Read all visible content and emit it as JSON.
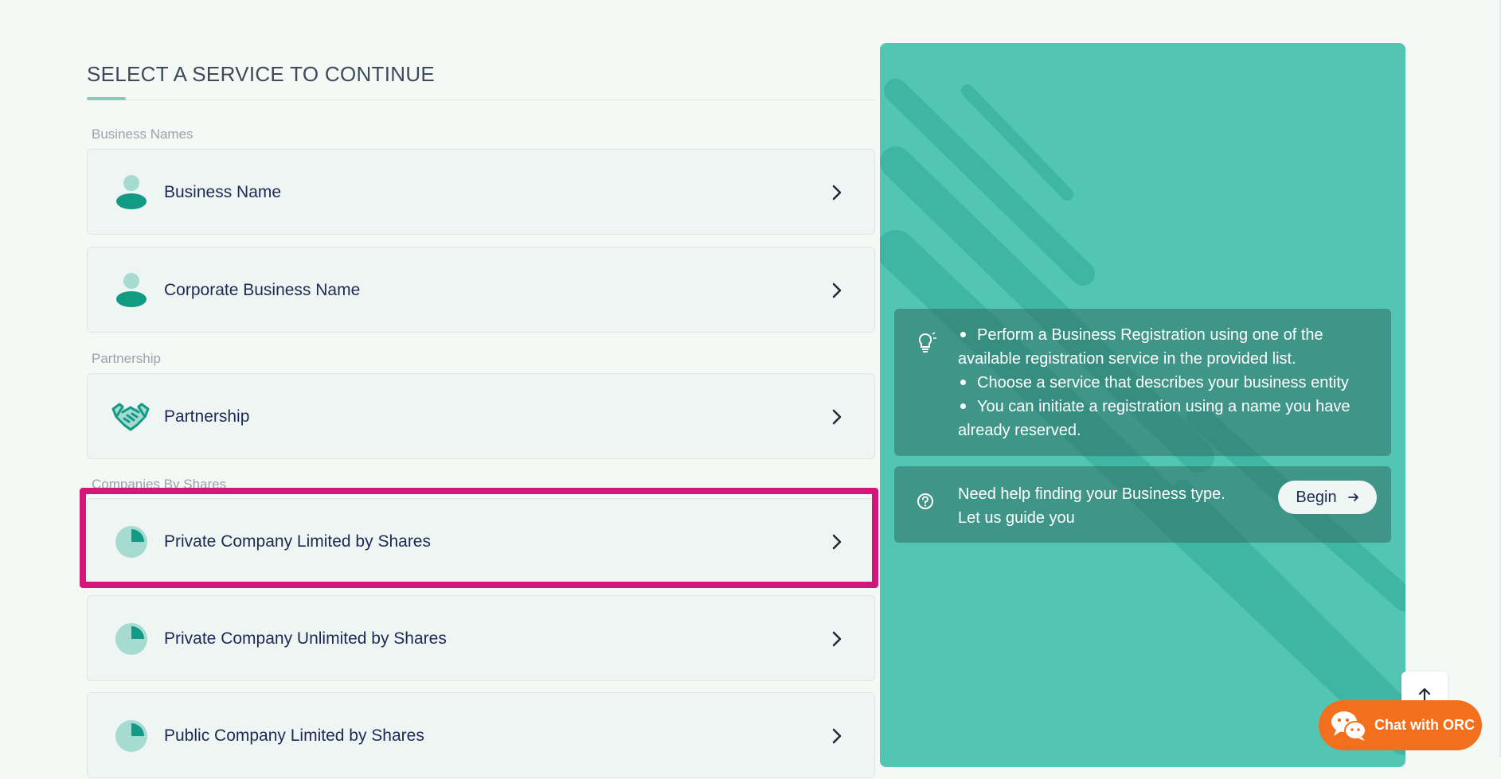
{
  "page": {
    "title": "SELECT A SERVICE TO CONTINUE"
  },
  "sections": {
    "business_names": "Business Names",
    "partnership": "Partnership",
    "companies_by_shares": "Companies By Shares"
  },
  "services": {
    "business_name": "Business Name",
    "corporate_business_name": "Corporate Business Name",
    "partnership": "Partnership",
    "private_limited_shares": "Private Company Limited by Shares",
    "private_unlimited_shares": "Private Company Unlimited by Shares",
    "public_limited_shares": "Public Company Limited by Shares"
  },
  "info": {
    "bullets": [
      "Perform a Business Registration using one of the available registration service in the provided list.",
      "Choose a service that describes your business entity",
      "You can initiate a registration using a name you have already reserved."
    ]
  },
  "help": {
    "line1": "Need help finding your Business type.",
    "line2": "Let us guide you",
    "button": "Begin"
  },
  "chat": {
    "label": "Chat with ORC"
  },
  "icons": {
    "person": "person-icon",
    "handshake": "handshake-icon",
    "pie": "pie-chart-icon",
    "chevron": "chevron-right-icon",
    "bulb": "lightbulb-icon",
    "question": "question-circle-icon",
    "arrow_right": "arrow-right-icon",
    "arrow_up": "arrow-up-icon",
    "chat": "chat-bubbles-icon"
  },
  "colors": {
    "accent_teal": "#52c6b3",
    "icon_teal": "#129a84",
    "icon_light": "#a6dbd1",
    "highlight": "#d4157a",
    "chat_orange": "#f2701d",
    "text_navy": "#1d2a55"
  }
}
